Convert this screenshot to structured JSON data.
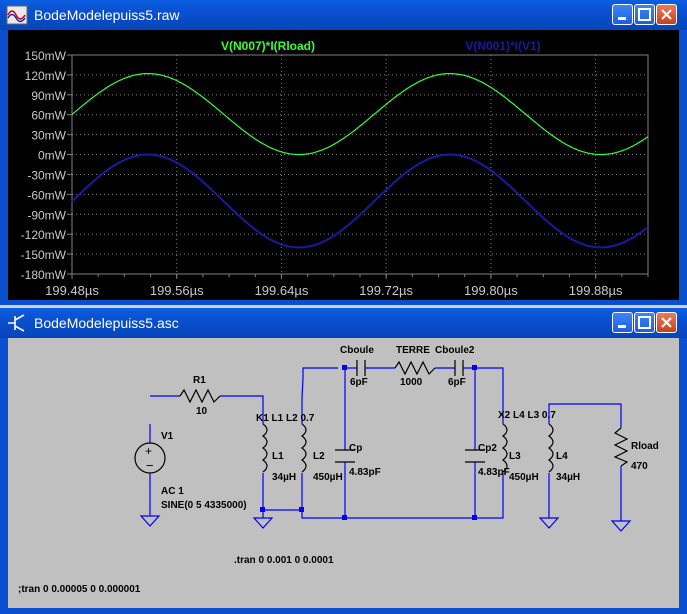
{
  "plot_window": {
    "title": "BodeModelepuiss5.raw",
    "trace1_label": "V(N007)*I(Rload)",
    "trace2_label": "V(N001)*I(V1)"
  },
  "schematic_window": {
    "title": "BodeModelepuiss5.asc"
  },
  "chart_data": {
    "type": "line",
    "xlim": [
      199.48,
      199.92
    ],
    "ylim": [
      -180,
      150
    ],
    "x_ticks": [
      "199.48µs",
      "199.56µs",
      "199.64µs",
      "199.72µs",
      "199.80µs",
      "199.88µs"
    ],
    "y_ticks": [
      "150mW",
      "120mW",
      "90mW",
      "60mW",
      "30mW",
      "0mW",
      "-30mW",
      "-60mW",
      "-90mW",
      "-120mW",
      "-150mW",
      "-180mW"
    ],
    "grid": true,
    "period_us": 0.2307,
    "series": [
      {
        "name": "V(N007)*I(Rload)",
        "color": "#33ff33",
        "offset_mw": 61,
        "amplitude_mw": 61,
        "peak_x_us": 199.538
      },
      {
        "name": "V(N001)*I(V1)",
        "color": "#1a1aa0",
        "offset_mw": -70,
        "amplitude_mw": 70,
        "peak_x_us": 199.538
      }
    ]
  },
  "colors": {
    "trace1": "#33ff33",
    "trace2": "#1a1aa0",
    "wire": "#0000ff",
    "text": "#000000"
  },
  "schematic": {
    "r1_name": "R1",
    "r1_value": "10",
    "v1_name": "V1",
    "v1_ac": "AC 1",
    "v1_sine": "SINE(0 5 4335000)",
    "k1": "K1 L1 L2 0.7",
    "l1_name": "L1",
    "l1_value": "34µH",
    "l2_name": "L2",
    "l2_value": "450µH",
    "cp_name": "Cp",
    "cp_value": "4.83pF",
    "cboule_name": "Cboule",
    "cboule_value": "6pF",
    "terre_name": "TERRE",
    "terre_value": "1000",
    "cboule2_name": "Cboule2",
    "cboule2_value": "6pF",
    "cp2_name": "Cp2",
    "cp2_value": "4.83pF",
    "l3_name": "L3",
    "l3_value": "450µH",
    "k2": "X2 L4 L3 0.7",
    "l4_name": "L4",
    "l4_value": "34µH",
    "rload_name": "Rload",
    "rload_value": "470",
    "tran1": ".tran 0 0.001 0 0.0001",
    "tran2": ";tran 0 0.00005 0 0.000001"
  }
}
